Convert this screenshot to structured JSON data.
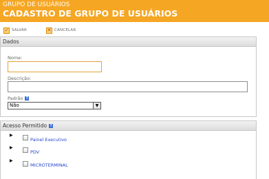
{
  "header": {
    "subtitle": "GRUPO DE USUÁRIOS",
    "title": "CADASTRO DE GRUPO DE USUÁRIOS"
  },
  "toolbar": {
    "save_label": "SALVAR",
    "cancel_label": "CANCELAR"
  },
  "dados": {
    "title": "Dados",
    "nome_label": "Nome:",
    "nome_value": "",
    "descricao_label": "Descrição:",
    "descricao_value": "",
    "padrao_label": "Padrão",
    "padrao_value": "Não"
  },
  "acesso": {
    "title": "Acesso Permitido",
    "items": [
      {
        "label": "Painel Executivo",
        "checked": false
      },
      {
        "label": "PDV",
        "checked": false
      },
      {
        "label": "MICROTERMINAL",
        "checked": false
      }
    ]
  },
  "colors": {
    "header": "#f5a623",
    "link": "#2244cc",
    "focus_border": "#e4a23a"
  }
}
